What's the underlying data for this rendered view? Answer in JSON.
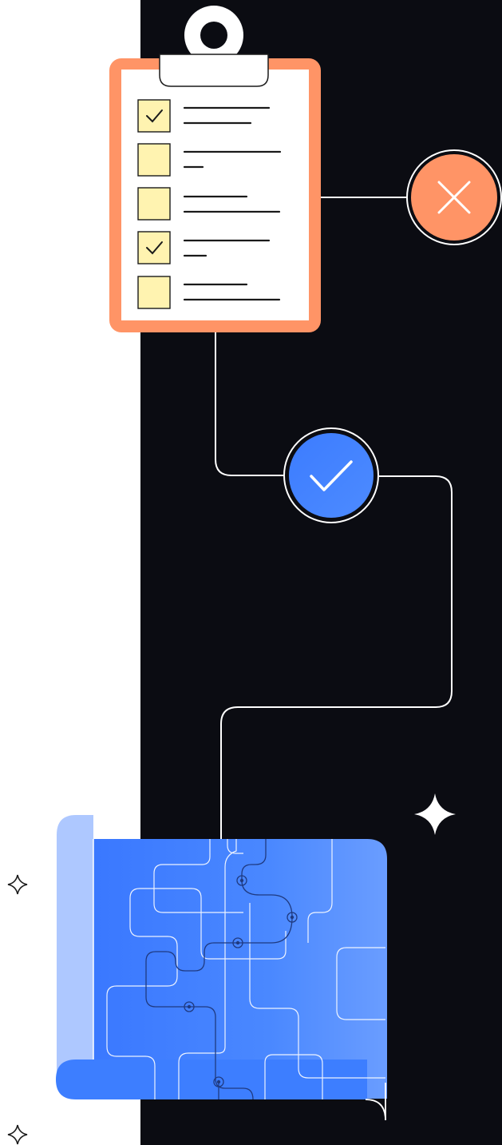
{
  "colors": {
    "background": "#ffffff",
    "dark_panel": "#0b0c12",
    "connector_line": "#ffffff",
    "clipboard_frame": "#ff9466",
    "clipboard_paper": "#ffffff",
    "clip": "#ffffff",
    "checkbox_fill": "#fff3b0",
    "outline": "#1a1a1a",
    "reject_fill": "#ff9466",
    "approve_fill": "#3b7bff",
    "map_blue": "#3d7eff",
    "map_blue_light": "#5f97ff",
    "map_fold": "#aec8ff",
    "sparkle": "#ffffff"
  },
  "icons": {
    "clipboard": "clipboard-checklist-icon",
    "reject": "x-mark-icon",
    "approve": "check-mark-icon",
    "map": "circuit-map-scroll-icon",
    "sparkle": "four-point-star-icon"
  },
  "checklist": [
    {
      "checked": true,
      "lines": 2
    },
    {
      "checked": false,
      "lines": 2
    },
    {
      "checked": false,
      "lines": 2
    },
    {
      "checked": true,
      "lines": 2
    },
    {
      "checked": false,
      "lines": 2
    }
  ]
}
